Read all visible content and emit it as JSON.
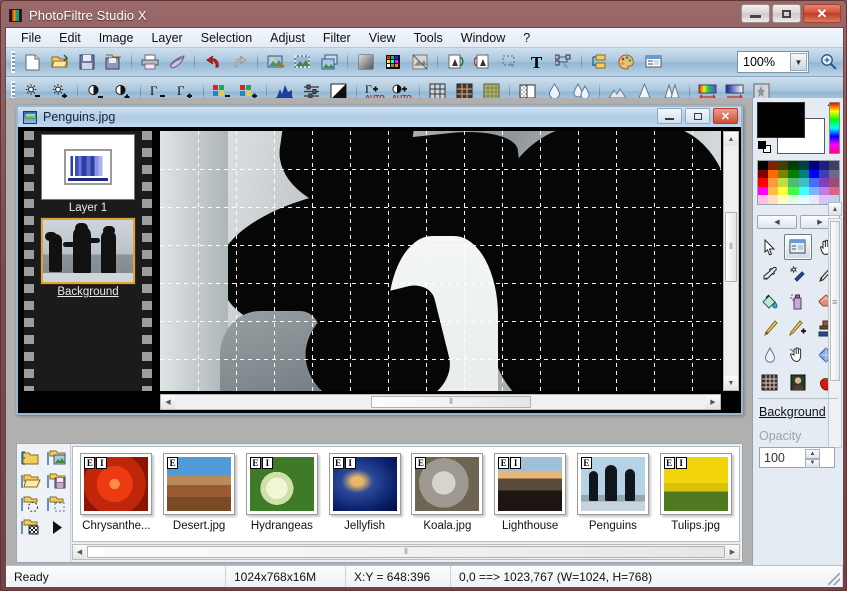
{
  "window": {
    "title": "PhotoFiltre Studio X",
    "app_icon": "filmstrip-color-icon",
    "buttons": {
      "minimize": "–",
      "maximize": "□",
      "close": "✕"
    }
  },
  "menubar": {
    "items": [
      "File",
      "Edit",
      "Image",
      "Layer",
      "Selection",
      "Adjust",
      "Filter",
      "View",
      "Tools",
      "Window",
      "?"
    ]
  },
  "toolbar_main": {
    "zoom_value": "100%",
    "groups": [
      {
        "buttons": [
          {
            "name": "new-icon",
            "glyph": "📄",
            "label": "New"
          },
          {
            "name": "open-icon",
            "glyph": "📂",
            "label": "Open"
          },
          {
            "name": "save-icon",
            "glyph": "💾",
            "label": "Save"
          },
          {
            "name": "save-as-icon",
            "glyph": "🗂",
            "label": "Save As"
          }
        ]
      },
      {
        "buttons": [
          {
            "name": "print-icon",
            "glyph": "🖨",
            "label": "Print"
          },
          {
            "name": "print-preview-icon",
            "glyph": "📠",
            "label": "Print Preview"
          }
        ]
      },
      {
        "buttons": [
          {
            "name": "undo-icon",
            "glyph": "↶",
            "label": "Undo"
          },
          {
            "name": "redo-icon",
            "glyph": "↷",
            "label": "Redo"
          }
        ]
      },
      {
        "buttons": [
          {
            "name": "image-size-icon",
            "glyph": "🖼",
            "label": "Image size"
          },
          {
            "name": "canvas-size-icon",
            "glyph": "🏞",
            "label": "Canvas size"
          },
          {
            "name": "duplicate-icon",
            "glyph": "🗾",
            "label": "Duplicate"
          }
        ]
      },
      {
        "buttons": [
          {
            "name": "grayscale-icon",
            "glyph": "◼",
            "label": "Grayscale"
          },
          {
            "name": "color-mode-icon",
            "glyph": "▦",
            "label": "Color mode"
          },
          {
            "name": "transparency-icon",
            "glyph": "▨",
            "label": "Transparency"
          }
        ]
      },
      {
        "buttons": [
          {
            "name": "rotate-left-icon",
            "glyph": "🗎",
            "label": "Rotate left"
          },
          {
            "name": "rotate-right-icon",
            "glyph": "🗏",
            "label": "Rotate right"
          },
          {
            "name": "crop-icon",
            "glyph": "⬚",
            "label": "Crop"
          },
          {
            "name": "text-icon",
            "glyph": "T",
            "label": "Text"
          },
          {
            "name": "vector-icon",
            "glyph": "⌁",
            "label": "Vector selection"
          }
        ]
      },
      {
        "buttons": [
          {
            "name": "layers-icon",
            "glyph": "🗂",
            "label": "Layers manager"
          },
          {
            "name": "palette-icon",
            "glyph": "🎨",
            "label": "Palette"
          },
          {
            "name": "browser-icon",
            "glyph": "🖥",
            "label": "Image browser"
          }
        ]
      }
    ]
  },
  "toolbar_adjust": {
    "groups": [
      {
        "buttons": [
          {
            "name": "brightness-minus-icon",
            "glyph": "☼−",
            "label": "Brightness −"
          },
          {
            "name": "brightness-plus-icon",
            "glyph": "☼+",
            "label": "Brightness +"
          }
        ]
      },
      {
        "buttons": [
          {
            "name": "contrast-minus-icon",
            "glyph": "◐−",
            "label": "Contrast −"
          },
          {
            "name": "contrast-plus-icon",
            "glyph": "◑+",
            "label": "Contrast +"
          }
        ]
      },
      {
        "buttons": [
          {
            "name": "gamma-minus-icon",
            "glyph": "Γ−",
            "label": "Gamma −"
          },
          {
            "name": "gamma-plus-icon",
            "glyph": "Γ+",
            "label": "Gamma +"
          }
        ]
      },
      {
        "buttons": [
          {
            "name": "saturation-minus-icon",
            "glyph": "▚−",
            "label": "Saturation −"
          },
          {
            "name": "saturation-plus-icon",
            "glyph": "▚+",
            "label": "Saturation +"
          }
        ]
      },
      {
        "buttons": [
          {
            "name": "histogram-icon",
            "glyph": "📊",
            "label": "Histogram"
          },
          {
            "name": "levels-icon",
            "glyph": "🎚",
            "label": "Levels"
          },
          {
            "name": "invert-icon",
            "glyph": "◨",
            "label": "Invert"
          }
        ]
      },
      {
        "buttons": [
          {
            "name": "auto-gamma-icon",
            "glyph": "Γ+",
            "label": "Auto gamma",
            "sub": "AUTO"
          },
          {
            "name": "auto-contrast-icon",
            "glyph": "◐+",
            "label": "Auto contrast",
            "sub": "AUTO"
          }
        ]
      },
      {
        "buttons": [
          {
            "name": "mosaic-icon",
            "glyph": "▦",
            "label": "Mosaic"
          },
          {
            "name": "dither-icon",
            "glyph": "▩",
            "label": "Dither"
          },
          {
            "name": "texture-icon",
            "glyph": "▩",
            "label": "Texture"
          }
        ]
      },
      {
        "buttons": [
          {
            "name": "halftone-icon",
            "glyph": "◫",
            "label": "Halftone"
          },
          {
            "name": "blur-icon",
            "glyph": "💧",
            "label": "Blur"
          },
          {
            "name": "blur-more-icon",
            "glyph": "💦",
            "label": "Blur more"
          }
        ]
      },
      {
        "buttons": [
          {
            "name": "relief-icon",
            "glyph": "⛰",
            "label": "Relief"
          },
          {
            "name": "sharpen-icon",
            "glyph": "🔺",
            "label": "Sharpen"
          },
          {
            "name": "sharpen-more-icon",
            "glyph": "🔻",
            "label": "Sharpen more"
          }
        ]
      },
      {
        "buttons": [
          {
            "name": "gradient-h-icon",
            "glyph": "🌈",
            "label": "Linear gradient"
          },
          {
            "name": "gradient-b-icon",
            "glyph": "🟦",
            "label": "Blue gradient"
          },
          {
            "name": "effect-icon",
            "glyph": "🗿",
            "label": "Effect"
          }
        ]
      }
    ]
  },
  "document": {
    "title": "Penguins.jpg",
    "icon": "image-document-icon",
    "buttons": {
      "minimize": "–",
      "maximize": "□",
      "close": "✕"
    },
    "layers": [
      {
        "name": "Layer 1",
        "type": "adjustment-histogram",
        "selected": false
      },
      {
        "name": "Background",
        "type": "image-penguins",
        "selected": true
      }
    ],
    "canvas": {
      "grid_visible": true,
      "grid_spacing_px": 38,
      "content": "grayscale penguin photo, zoomed"
    }
  },
  "browser": {
    "tools": [
      {
        "name": "folder-open-icon",
        "glyph": "📂"
      },
      {
        "name": "folder-image-icon",
        "glyph": "🖼"
      },
      {
        "name": "folder-browse-icon",
        "glyph": "📁"
      },
      {
        "name": "folder-save-icon",
        "glyph": "💾"
      },
      {
        "name": "folder-select-icon",
        "glyph": "⬚"
      },
      {
        "name": "folder-deselect-icon",
        "glyph": "⬚"
      },
      {
        "name": "folder-transparent-icon",
        "glyph": "▨"
      },
      {
        "name": "slideshow-play-icon",
        "glyph": "▶"
      }
    ],
    "thumbnails": [
      {
        "name": "Chrysanthe...",
        "badges": [
          "E",
          "I"
        ],
        "swatch": "#c1260b",
        "swatch2": "#7a1405"
      },
      {
        "name": "Desert.jpg",
        "badges": [
          "E"
        ],
        "swatch": "#a85c32",
        "swatch2": "#3f84c4"
      },
      {
        "name": "Hydrangeas",
        "badges": [
          "E",
          "I"
        ],
        "swatch": "#3c6a24",
        "swatch2": "#dfe8c8"
      },
      {
        "name": "Jellyfish",
        "badges": [
          "E",
          "I"
        ],
        "swatch": "#0a1f6b",
        "swatch2": "#d9a45a"
      },
      {
        "name": "Koala.jpg",
        "badges": [
          "E"
        ],
        "swatch": "#7a6a52",
        "swatch2": "#b9b2a6"
      },
      {
        "name": "Lighthouse",
        "badges": [
          "E",
          "I"
        ],
        "swatch": "#231a16",
        "swatch2": "#e8b67a"
      },
      {
        "name": "Penguins",
        "badges": [
          "E"
        ],
        "swatch": "#8fb6d4",
        "swatch2": "#1a1a1a"
      },
      {
        "name": "Tulips.jpg",
        "badges": [
          "E",
          "I"
        ],
        "swatch": "#e8c007",
        "swatch2": "#4f7a22"
      }
    ]
  },
  "right_panel": {
    "foreground_color": "#000000",
    "background_color": "#ffffff",
    "swap_icon": "swap-colors-icon",
    "reset_icon": "reset-colors-icon",
    "palette_nav": {
      "prev": "◀",
      "next": "▶"
    },
    "palette_colors": [
      "#000000",
      "#7f2200",
      "#3f3f00",
      "#003f00",
      "#00403f",
      "#00007f",
      "#1f1f7f",
      "#3f3f5f",
      "#7f0000",
      "#ff6a00",
      "#7f7f00",
      "#007f00",
      "#007f7f",
      "#0000ff",
      "#3f3faf",
      "#6a6a8f",
      "#ff0000",
      "#ff9a3a",
      "#bfdf3f",
      "#4fbf6f",
      "#3fbfbf",
      "#3f6fff",
      "#7f3fbf",
      "#9a4f6f",
      "#ff00ff",
      "#ffc03f",
      "#ffff3f",
      "#3fff3f",
      "#3fffff",
      "#7fafff",
      "#bf7fdf",
      "#df5f8f",
      "#ffbfdf",
      "#ffdfbf",
      "#ffffbf",
      "#dfffdf",
      "#dfffff",
      "#bfdfff",
      "#dfbfff",
      "#bfcfef"
    ],
    "tools": [
      {
        "name": "select-arrow-tool",
        "glyph": "➤",
        "active": false
      },
      {
        "name": "image-tool",
        "glyph": "🗔",
        "active": true
      },
      {
        "name": "hand-tool",
        "glyph": "✋",
        "active": false
      },
      {
        "name": "eyedropper-tool",
        "glyph": "🖊",
        "active": false
      },
      {
        "name": "magic-wand-tool",
        "glyph": "🪄",
        "active": false
      },
      {
        "name": "line-tool",
        "glyph": "🖋",
        "active": false
      },
      {
        "name": "paint-bucket-tool",
        "glyph": "🪣",
        "active": false
      },
      {
        "name": "spray-tool",
        "glyph": "🧴",
        "active": false
      },
      {
        "name": "eraser-tool",
        "glyph": "🧽",
        "active": false
      },
      {
        "name": "paintbrush-tool",
        "glyph": "🖌",
        "active": false
      },
      {
        "name": "paintbrush-plus-tool",
        "glyph": "🖌",
        "active": false
      },
      {
        "name": "stamp-tool",
        "glyph": "🔨",
        "active": false
      },
      {
        "name": "water-drop-tool",
        "glyph": "💧",
        "active": false
      },
      {
        "name": "smudge-tool",
        "glyph": "👋",
        "active": false
      },
      {
        "name": "gem-tool",
        "glyph": "🔷",
        "active": false
      },
      {
        "name": "grid-tool",
        "glyph": "▦",
        "active": false
      },
      {
        "name": "portrait-tool",
        "glyph": "🖼",
        "active": false
      },
      {
        "name": "strawberry-tool",
        "glyph": "🍓",
        "active": false
      }
    ],
    "layer_name": "Background",
    "opacity_label": "Opacity",
    "opacity_value": "100"
  },
  "statusbar": {
    "ready": "Ready",
    "image_size": "1024x768x16M",
    "cursor_xy": "X:Y = 648:396",
    "selection": "0,0 ==> 1023,767 (W=1024, H=768)"
  }
}
